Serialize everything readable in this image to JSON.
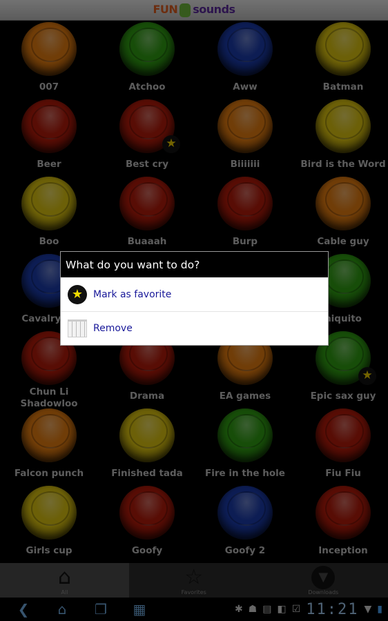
{
  "header": {
    "logo_left": "FUN",
    "logo_right": "sounds"
  },
  "sounds": [
    {
      "label": "007",
      "color": "#e07a10"
    },
    {
      "label": "Atchoo",
      "color": "#2e9a12"
    },
    {
      "label": "Aww",
      "color": "#1a3aa8"
    },
    {
      "label": "Batman",
      "color": "#d8c010"
    },
    {
      "label": "Beer",
      "color": "#b01a0a"
    },
    {
      "label": "Best cry",
      "color": "#b01a0a",
      "favorite": true
    },
    {
      "label": "Biiiiiii",
      "color": "#e07a10"
    },
    {
      "label": "Bird is the Word",
      "color": "#d8c010"
    },
    {
      "label": "Boo",
      "color": "#d8c010"
    },
    {
      "label": "Buaaah",
      "color": "#b01a0a"
    },
    {
      "label": "Burp",
      "color": "#b01a0a"
    },
    {
      "label": "Cable guy",
      "color": "#e07a10"
    },
    {
      "label": "Cavalry ch",
      "color": "#1a3aa8"
    },
    {
      "label": "",
      "color": "#2e9a12"
    },
    {
      "label": "",
      "color": "#b01a0a"
    },
    {
      "label": "niquito",
      "color": "#2e9a12"
    },
    {
      "label": "Chun Li Shadowloo",
      "color": "#b01a0a"
    },
    {
      "label": "Drama",
      "color": "#b01a0a"
    },
    {
      "label": "EA games",
      "color": "#e07a10"
    },
    {
      "label": "Epic sax guy",
      "color": "#2e9a12",
      "favorite": true
    },
    {
      "label": "Falcon punch",
      "color": "#e07a10"
    },
    {
      "label": "Finished tada",
      "color": "#d8c010"
    },
    {
      "label": "Fire in the hole",
      "color": "#2e9a12"
    },
    {
      "label": "Fiu Fiu",
      "color": "#b01a0a"
    },
    {
      "label": "Girls cup",
      "color": "#d8c010"
    },
    {
      "label": "Goofy",
      "color": "#b01a0a"
    },
    {
      "label": "Goofy 2",
      "color": "#1a3aa8"
    },
    {
      "label": "Inception",
      "color": "#b01a0a"
    }
  ],
  "tabs": [
    {
      "label": "All",
      "icon": "home-icon",
      "active": true
    },
    {
      "label": "Favorites",
      "icon": "star-icon"
    },
    {
      "label": "Downloads",
      "icon": "download-icon"
    }
  ],
  "dialog": {
    "title": "What do you want to do?",
    "items": [
      {
        "label": "Mark as favorite",
        "icon": "star-icon"
      },
      {
        "label": "Remove",
        "icon": "trash-icon"
      }
    ]
  },
  "status": {
    "time": "11:21"
  }
}
